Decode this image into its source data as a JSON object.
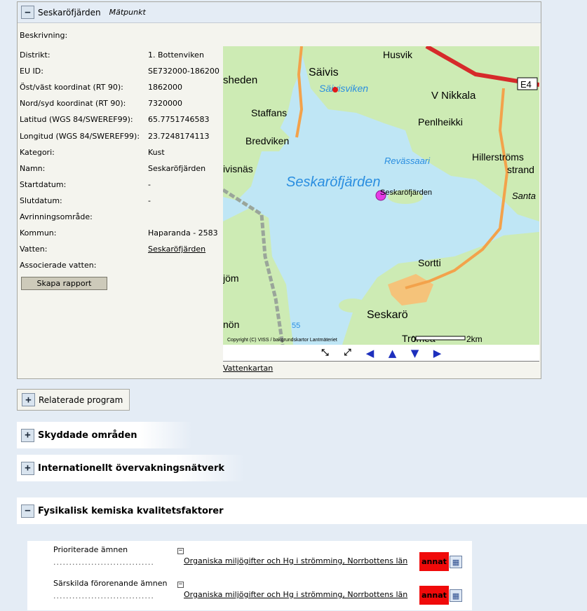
{
  "station": {
    "name": "Seskaröfjärden",
    "type": "Mätpunkt",
    "toggle": "−",
    "description_label": "Beskrivning:",
    "fields": [
      {
        "label": "Distrikt:",
        "value": "1. Bottenviken",
        "link": false
      },
      {
        "label": "EU ID:",
        "value": "SE732000-186200",
        "link": false
      },
      {
        "label": "Öst/väst koordinat (RT 90):",
        "value": "1862000",
        "link": false
      },
      {
        "label": "Nord/syd koordinat (RT 90):",
        "value": "7320000",
        "link": false
      },
      {
        "label": "Latitud (WGS 84/SWEREF99):",
        "value": "65.7751746583",
        "link": false
      },
      {
        "label": "Longitud (WGS 84/SWEREF99):",
        "value": "23.7248174113",
        "link": false
      },
      {
        "label": "Kategori:",
        "value": "Kust",
        "link": false
      },
      {
        "label": "Namn:",
        "value": "Seskaröfjärden",
        "link": false
      },
      {
        "label": "Startdatum:",
        "value": "-",
        "link": false
      },
      {
        "label": "Slutdatum:",
        "value": "-",
        "link": false
      },
      {
        "label": "Avrinningsområde:",
        "value": "",
        "link": false
      },
      {
        "label": "Kommun:",
        "value": "Haparanda - 2583",
        "link": false
      },
      {
        "label": "Vatten:",
        "value": "Seskaröfjärden",
        "link": true
      },
      {
        "label": "Associerade vatten:",
        "value": "",
        "link": false
      }
    ],
    "report_button": "Skapa rapport"
  },
  "map": {
    "labels": {
      "husvik": "Husvik",
      "e4": "E4",
      "saivis": "Säivis",
      "saivisviken": "Säivisviken",
      "sheden": "sheden",
      "v_nikkala": "V Nikkala",
      "staffans": "Staffans",
      "penlheikki": "Penlheikki",
      "bredviken": "Bredviken",
      "hillerstroms": "Hillerströms",
      "strand": "strand",
      "revassaari": "Revässaari",
      "vivisnas": "ivisnäs",
      "seskarofjarden": "Seskaröfjärden",
      "santa": "Santa",
      "point": "Seskaröfjärden",
      "jom": "jöm",
      "sortti": "Sortti",
      "seskaro": "Seskarö",
      "non": "nön",
      "tromea": "Tromea",
      "n55": "55",
      "copyright": "Copyright (C) VISS / bakgrundskartor Lantmäteriet",
      "scale_0": "0",
      "scale_2": "2km"
    },
    "colors": {
      "water": "#bfe6f5",
      "land": "#cdebb4",
      "road": "#f3a24b",
      "highway": "#d62a2a",
      "urban": "#f5c37a",
      "point": "#e53be5"
    },
    "controls": {
      "zoom_in_icon": "⤡",
      "zoom_out_icon": "⤢",
      "left": "◀",
      "up": "▲",
      "down": "▼",
      "right": "▶"
    },
    "link": "Vattenkartan"
  },
  "sections": {
    "related": {
      "toggle": "+",
      "label": "Relaterade program"
    },
    "skyddade": {
      "toggle": "+",
      "label": "Skyddade områden"
    },
    "internationellt": {
      "toggle": "+",
      "label": "Internationellt övervakningsnätverk"
    },
    "fysikalisk": {
      "toggle": "−",
      "label": "Fysikalisk kemiska kvalitetsfaktorer"
    }
  },
  "fysikalisk_rows": [
    {
      "label": "Prioriterade ämnen",
      "dots": "................................",
      "mini": "−",
      "link": "Organiska miljögifter och Hg i strömming, Norrbottens län",
      "badge": "annat",
      "icon": "▦"
    },
    {
      "label": "Särskilda förorenande ämnen",
      "dots": "................................",
      "mini": "−",
      "link": "Organiska miljögifter och Hg i strömming, Norrbottens län",
      "badge": "annat",
      "icon": "▦"
    }
  ]
}
